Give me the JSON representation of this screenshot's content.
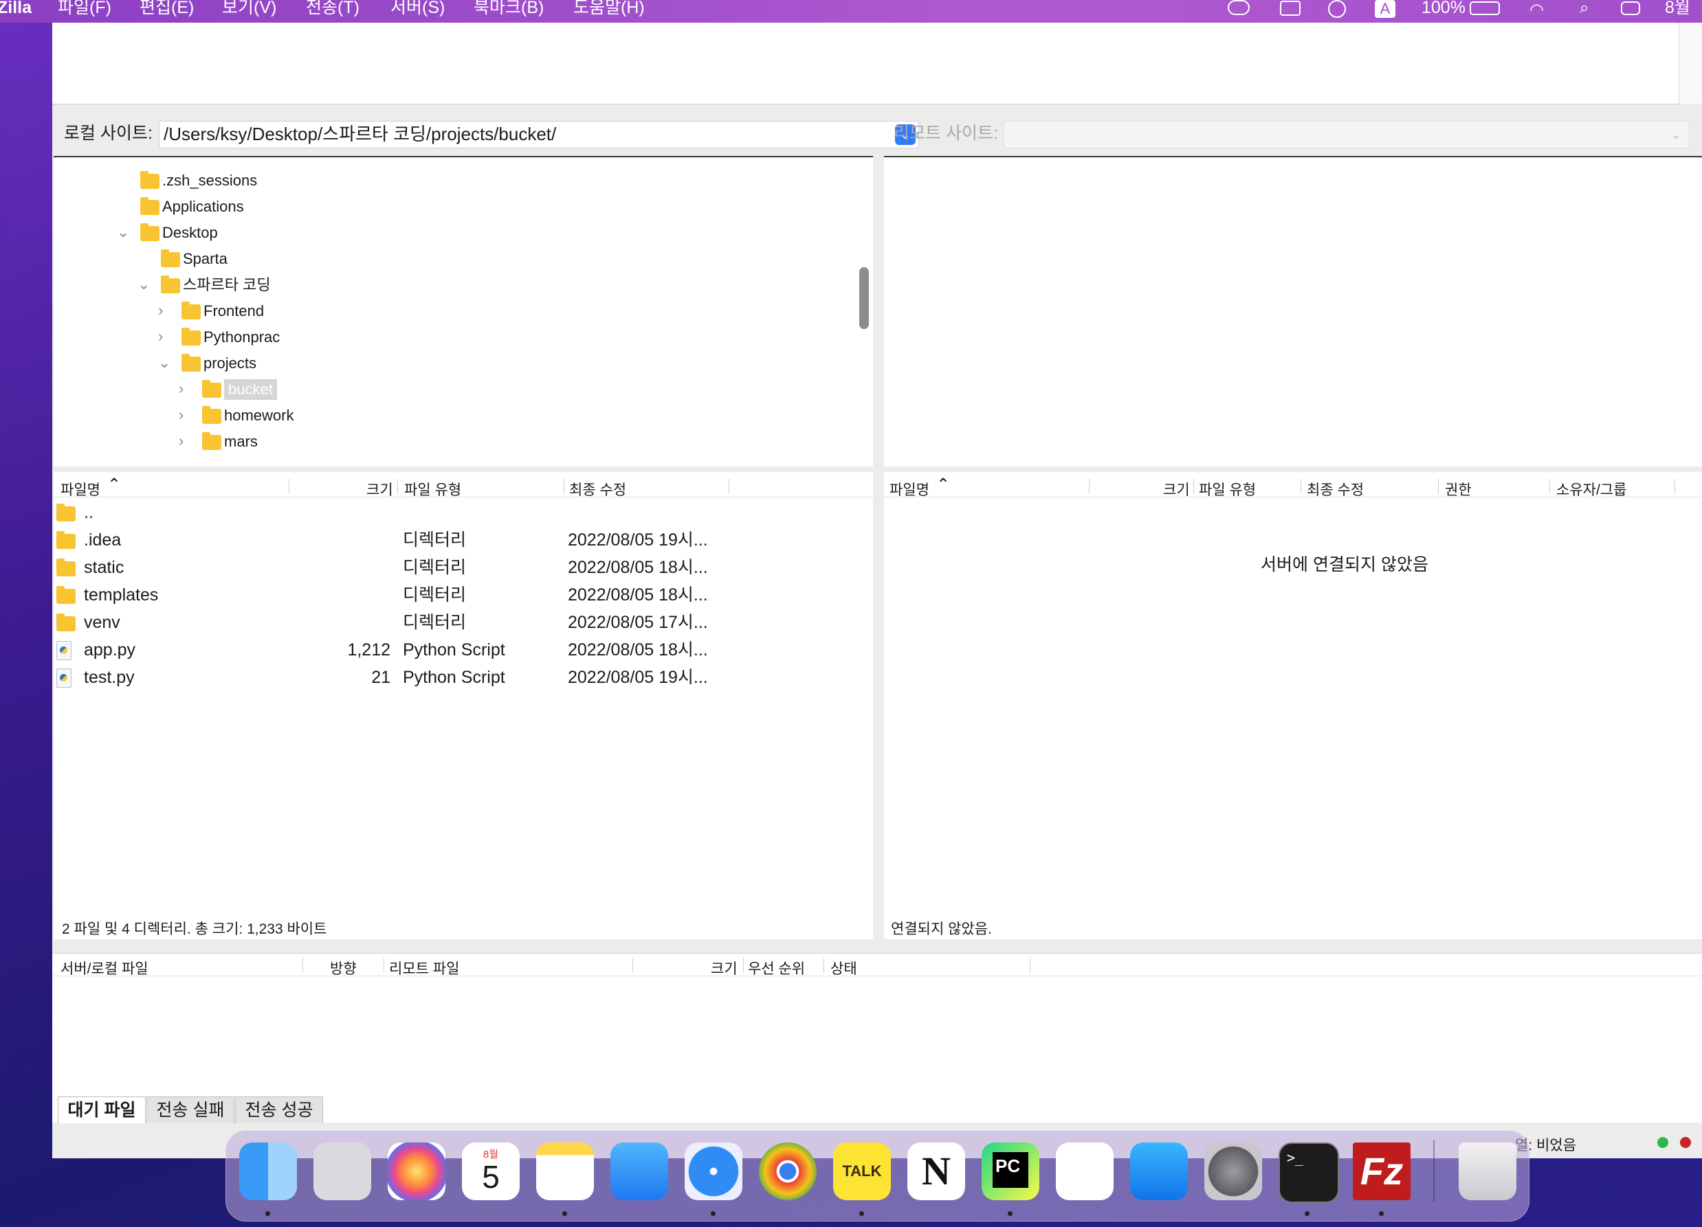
{
  "menubar": {
    "app_name": "Zilla",
    "menus": [
      "파일(F)",
      "편집(E)",
      "보기(V)",
      "전송(T)",
      "서버(S)",
      "북마크(B)",
      "도움말(H)"
    ],
    "battery": "100%",
    "clock": "8월"
  },
  "local": {
    "label": "로컬 사이트:",
    "path": "/Users/ksy/Desktop/스파르타 코딩/projects/bucket/",
    "tree": [
      {
        "name": ".zsh_sessions",
        "expanded": null
      },
      {
        "name": "Applications",
        "expanded": null
      },
      {
        "name": "Desktop",
        "expanded": true
      },
      {
        "name": "Sparta",
        "expanded": null
      },
      {
        "name": "스파르타 코딩",
        "expanded": true
      },
      {
        "name": "Frontend",
        "expanded": false
      },
      {
        "name": "Pythonprac",
        "expanded": false
      },
      {
        "name": "projects",
        "expanded": true
      },
      {
        "name": "bucket",
        "expanded": false,
        "selected": true
      },
      {
        "name": "homework",
        "expanded": false
      },
      {
        "name": "mars",
        "expanded": false
      }
    ],
    "columns": {
      "name": "파일명",
      "size": "크기",
      "type": "파일 유형",
      "modified": "최종 수정"
    },
    "files": [
      {
        "name": "..",
        "size": "",
        "type": "",
        "modified": "",
        "icon": "folder-icon"
      },
      {
        "name": ".idea",
        "size": "",
        "type": "디렉터리",
        "modified": "2022/08/05 19시...",
        "icon": "folder-icon"
      },
      {
        "name": "static",
        "size": "",
        "type": "디렉터리",
        "modified": "2022/08/05 18시...",
        "icon": "folder-icon"
      },
      {
        "name": "templates",
        "size": "",
        "type": "디렉터리",
        "modified": "2022/08/05 18시...",
        "icon": "folder-icon"
      },
      {
        "name": "venv",
        "size": "",
        "type": "디렉터리",
        "modified": "2022/08/05 17시...",
        "icon": "folder-icon"
      },
      {
        "name": "app.py",
        "size": "1,212",
        "type": "Python Script",
        "modified": "2022/08/05 18시...",
        "icon": "python-file-icon"
      },
      {
        "name": "test.py",
        "size": "21",
        "type": "Python Script",
        "modified": "2022/08/05 19시...",
        "icon": "python-file-icon"
      }
    ],
    "status": "2 파일 및 4 디렉터리. 총 크기: 1,233 바이트"
  },
  "remote": {
    "label": "리모트 사이트:",
    "columns": {
      "name": "파일명",
      "size": "크기",
      "type": "파일 유형",
      "modified": "최종 수정",
      "perm": "권한",
      "owner": "소유자/그룹"
    },
    "empty_message": "서버에 연결되지 않았음",
    "status": "연결되지 않았음."
  },
  "queue": {
    "columns": {
      "server_file": "서버/로컬 파일",
      "direction": "방향",
      "remote_file": "리모트 파일",
      "size": "크기",
      "priority": "우선 순위",
      "status": "상태"
    },
    "tabs": [
      "대기 파일",
      "전송 실패",
      "전송 성공"
    ],
    "status_text": "열: 비었음"
  },
  "dock": [
    "finder-icon",
    "launchpad-icon",
    "photos-icon",
    "calendar-icon",
    "notes-icon",
    "mail-icon",
    "safari-icon",
    "chrome-icon",
    "kakaotalk-icon",
    "notion-icon",
    "pycharm-icon",
    "vscode-icon",
    "app-store-icon",
    "system-preferences-icon",
    "terminal-icon",
    "filezilla-icon",
    "trash-icon"
  ],
  "dock_labels": {
    "calendar_month": "8월",
    "calendar_day": "5",
    "kakao": "TALK",
    "notion": "N",
    "pycharm": "PC",
    "filezilla": "Fz"
  }
}
